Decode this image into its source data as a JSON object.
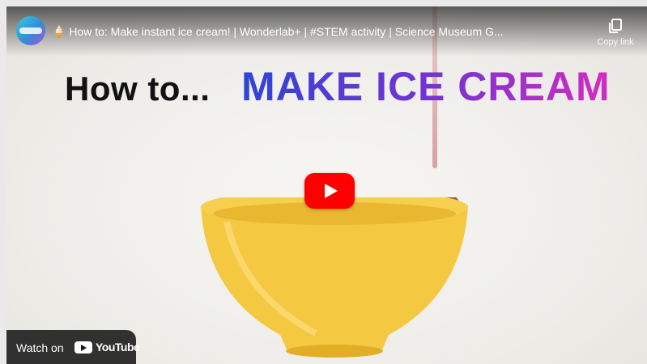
{
  "video": {
    "title": "🍦 How to: Make instant ice cream! | Wonderlab+ | #STEM activity | Science Museum G...",
    "copy_link_label": "Copy link",
    "headline_prefix": "How to...",
    "headline_main": "MAKE ICE CREAM"
  },
  "player": {
    "watch_on_label": "Watch on",
    "platform_label": "YouTube",
    "play_button_color": "#ff0000"
  },
  "colors": {
    "bowl": "#f5c842",
    "headline_gradient_start": "#2f44d6",
    "headline_gradient_end": "#d42cc2"
  }
}
